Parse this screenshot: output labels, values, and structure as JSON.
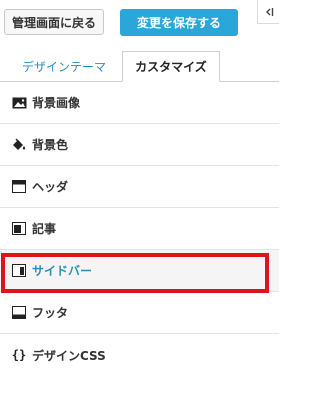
{
  "toolbar": {
    "back_label": "管理画面に戻る",
    "save_label": "変更を保存する",
    "collapse_icon": "collapse-left-icon"
  },
  "tabs": [
    {
      "label": "デザインテーマ",
      "active": false
    },
    {
      "label": "カスタマイズ",
      "active": true
    }
  ],
  "menu": {
    "items": [
      {
        "label": "背景画像",
        "icon": "image-icon"
      },
      {
        "label": "背景色",
        "icon": "paint-bucket-icon"
      },
      {
        "label": "ヘッダ",
        "icon": "header-layout-icon"
      },
      {
        "label": "記事",
        "icon": "article-layout-icon"
      },
      {
        "label": "サイドバー",
        "icon": "sidebar-layout-icon",
        "active": true
      },
      {
        "label": "フッタ",
        "icon": "footer-layout-icon"
      },
      {
        "label": "デザインCSS",
        "icon": "css-braces-icon"
      }
    ]
  },
  "colors": {
    "accent": "#2aa7d8",
    "highlight_border": "#e0121a"
  }
}
